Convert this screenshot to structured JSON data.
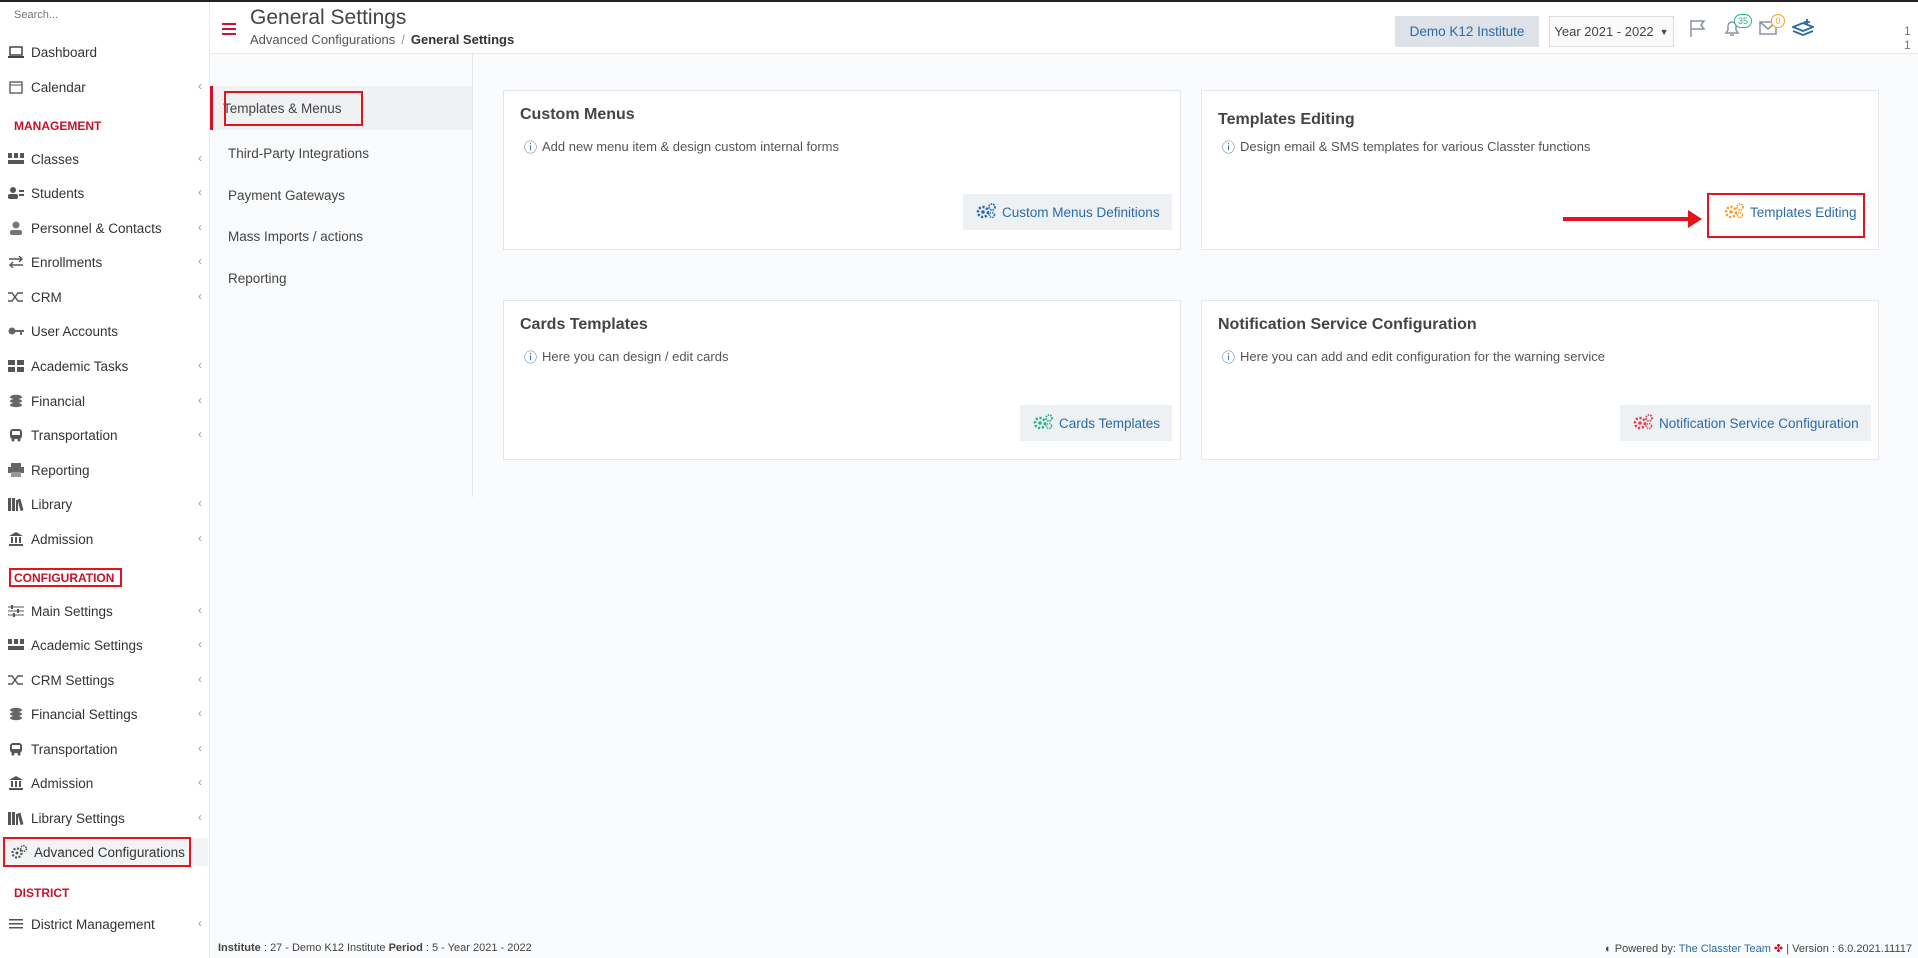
{
  "search": {
    "placeholder": "Search..."
  },
  "sidebar": {
    "items": [
      {
        "label": "Dashboard",
        "icon": "laptop-icon"
      },
      {
        "label": "Calendar",
        "icon": "calendar-icon"
      },
      {
        "label": "Classes",
        "icon": "classes-icon"
      },
      {
        "label": "Students",
        "icon": "students-icon"
      },
      {
        "label": "Personnel & Contacts",
        "icon": "person-icon"
      },
      {
        "label": "Enrollments",
        "icon": "exchange-icon"
      },
      {
        "label": "CRM",
        "icon": "shuffle-icon"
      },
      {
        "label": "User Accounts",
        "icon": "key-icon"
      },
      {
        "label": "Academic Tasks",
        "icon": "grid-icon"
      },
      {
        "label": "Financial",
        "icon": "coins-icon"
      },
      {
        "label": "Transportation",
        "icon": "bus-icon"
      },
      {
        "label": "Reporting",
        "icon": "printer-icon"
      },
      {
        "label": "Library",
        "icon": "books-icon"
      },
      {
        "label": "Admission",
        "icon": "bank-icon"
      },
      {
        "label": "Main Settings",
        "icon": "sliders-icon"
      },
      {
        "label": "Academic Settings",
        "icon": "classes-icon"
      },
      {
        "label": "CRM Settings",
        "icon": "shuffle-icon"
      },
      {
        "label": "Financial Settings",
        "icon": "coins-icon"
      },
      {
        "label": "Transportation",
        "icon": "bus-icon"
      },
      {
        "label": "Admission",
        "icon": "bank-icon"
      },
      {
        "label": "Library Settings",
        "icon": "books-icon"
      },
      {
        "label": "Advanced Configurations",
        "icon": "gears-icon"
      },
      {
        "label": "District Management",
        "icon": "list-icon"
      }
    ],
    "sections": {
      "management": "MANAGEMENT",
      "configuration": "CONFIGURATION",
      "district": "DISTRICT"
    }
  },
  "header": {
    "title": "General Settings",
    "breadcrumb": {
      "parent": "Advanced Configurations",
      "current": "General Settings"
    },
    "institute": "Demo K12 Institute",
    "year": "Year 2021 - 2022",
    "notifications_count": "35",
    "messages_count": "0",
    "user_number": "1 1"
  },
  "subnav": {
    "items": [
      "Templates & Menus",
      "Third-Party Integrations",
      "Payment Gateways",
      "Mass Imports / actions",
      "Reporting"
    ]
  },
  "cards": {
    "custom_menus": {
      "title": "Custom Menus",
      "desc": "Add new menu item & design custom internal forms",
      "button": "Custom Menus Definitions"
    },
    "templates_editing": {
      "title": "Templates Editing",
      "desc": "Design email & SMS templates for various Classter functions",
      "button": "Templates Editing"
    },
    "cards_templates": {
      "title": "Cards Templates",
      "desc": "Here you can design / edit cards",
      "button": "Cards Templates"
    },
    "notification": {
      "title": "Notification Service Configuration",
      "desc": "Here you can add and edit configuration for the warning service",
      "button": "Notification Service Configuration"
    }
  },
  "colors": {
    "accent": "#d0112b",
    "link": "#2b6aa6",
    "highlight": "#e3141e",
    "orange_gear": "#f0a030",
    "green_gear": "#2bb08a",
    "red_gear": "#e04050"
  },
  "footer": {
    "institute_label": "Institute",
    "institute_value": ": 27 - Demo K12 Institute",
    "period_label": "Period",
    "period_value": ": 5 - Year 2021 - 2022",
    "powered_label": "Powered by:",
    "powered_link": "The Classter Team",
    "version": "| Version : 6.0.2021.11117"
  }
}
